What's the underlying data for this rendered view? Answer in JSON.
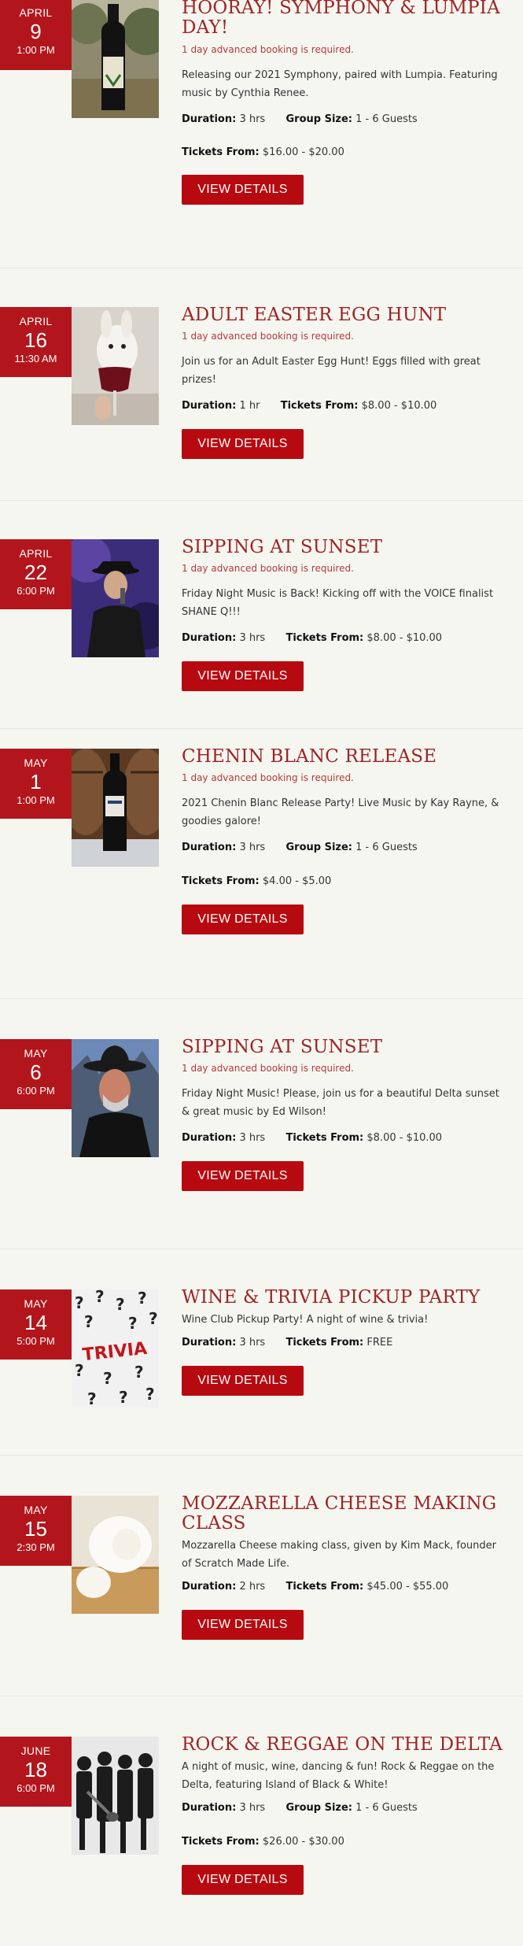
{
  "view_details_label": "VIEW DETAILS",
  "labels": {
    "duration": "Duration:",
    "group_size": "Group Size:",
    "tickets_from": "Tickets From:"
  },
  "events": [
    {
      "month": "APRIL",
      "day": "9",
      "time": "1:00 PM",
      "title": "HOORAY! SYMPHONY & LUMPIA DAY!",
      "notice": "1 day advanced booking is required.",
      "description": "Releasing our 2021 Symphony, paired with Lumpia. Featuring music by Cynthia Renee.",
      "duration": "3 hrs",
      "group_size": "1 - 6 Guests",
      "tickets": "$16.00 - $20.00",
      "image": "wine-bottle"
    },
    {
      "month": "APRIL",
      "day": "16",
      "time": "11:30 AM",
      "title": "ADULT EASTER EGG HUNT",
      "notice": "1 day advanced booking is required.",
      "description": "Join us for an Adult Easter Egg Hunt! Eggs filled with great prizes!",
      "duration": "1 hr",
      "tickets": "$8.00 - $10.00",
      "image": "bunny-wine-glass"
    },
    {
      "month": "APRIL",
      "day": "22",
      "time": "6:00 PM",
      "title": "SIPPING AT SUNSET",
      "notice": "1 day advanced booking is required.",
      "description": "Friday Night Music is Back! Kicking off with the VOICE finalist SHANE Q!!!",
      "duration": "3 hrs",
      "tickets": "$8.00 - $10.00",
      "image": "singer-hat"
    },
    {
      "month": "MAY",
      "day": "1",
      "time": "1:00 PM",
      "title": "CHENIN BLANC RELEASE",
      "notice": "1 day advanced booking is required.",
      "description": "2021 Chenin Blanc Release Party! Live Music by Kay Rayne, & goodies galore!",
      "duration": "3 hrs",
      "group_size": "1 - 6 Guests",
      "tickets": "$4.00 - $5.00",
      "image": "wine-bottle-barrels"
    },
    {
      "month": "MAY",
      "day": "6",
      "time": "6:00 PM",
      "title": "SIPPING AT SUNSET",
      "notice": "1 day advanced booking is required.",
      "description": "Friday Night Music! Please, join us for a beautiful Delta sunset & great music by Ed Wilson!",
      "duration": "3 hrs",
      "tickets": "$8.00 - $10.00",
      "image": "cowboy-musician"
    },
    {
      "month": "MAY",
      "day": "14",
      "time": "5:00 PM",
      "title": "WINE & TRIVIA PICKUP PARTY",
      "description": "Wine Club Pickup Party! A night of wine & trivia!",
      "duration": "3 hrs",
      "tickets": "FREE",
      "image": "trivia",
      "image_text": "TRIVIA"
    },
    {
      "month": "MAY",
      "day": "15",
      "time": "2:30 PM",
      "title": "MOZZARELLA CHEESE MAKING CLASS",
      "description": "Mozzarella Cheese making class, given by Kim Mack, founder of Scratch Made Life.",
      "duration": "2 hrs",
      "tickets": "$45.00 - $55.00",
      "image": "mozzarella"
    },
    {
      "month": "JUNE",
      "day": "18",
      "time": "6:00 PM",
      "title": "ROCK & REGGAE ON THE DELTA",
      "description": "A night of music, wine, dancing & fun! Rock & Reggae on the Delta, featuring Island of Black & White!",
      "duration": "3 hrs",
      "group_size": "1 - 6 Guests",
      "tickets": "$26.00 - $30.00",
      "image": "band-photo"
    }
  ]
}
